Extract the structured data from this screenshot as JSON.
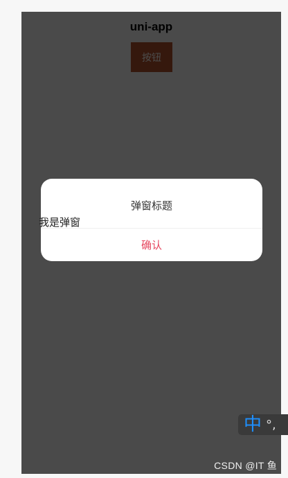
{
  "navbar": {
    "title": "uni-app"
  },
  "page": {
    "button_label": "按钮"
  },
  "dialog": {
    "title": "弹窗标题",
    "content": "我是弹窗",
    "confirm_label": "确认"
  },
  "ime": {
    "mode": "中",
    "punct": "°,"
  },
  "watermark": "CSDN @IT 鱼"
}
